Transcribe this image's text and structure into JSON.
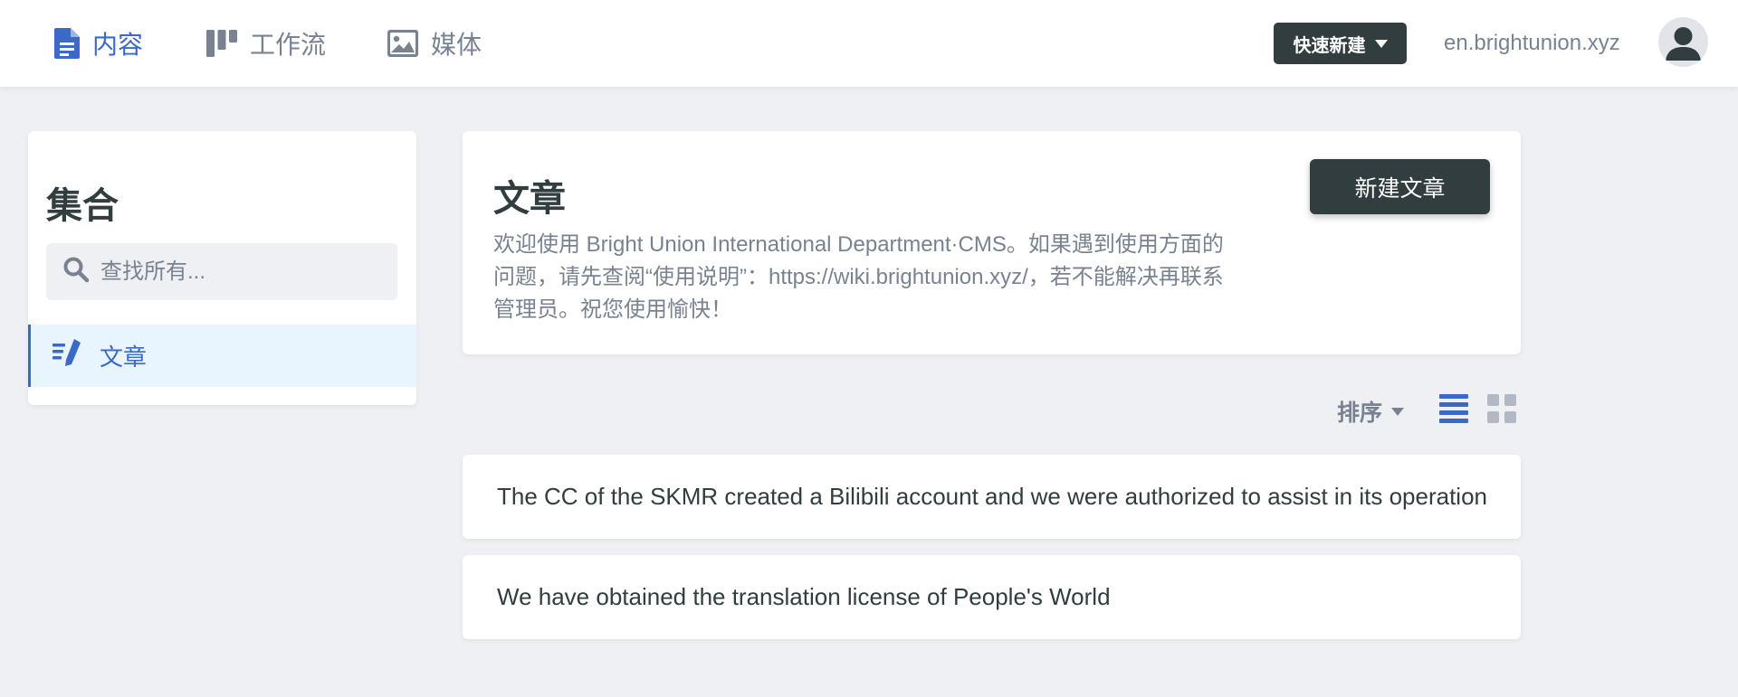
{
  "nav": {
    "tabs": [
      {
        "label": "内容",
        "icon": "document-icon",
        "active": true
      },
      {
        "label": "工作流",
        "icon": "workflow-board-icon",
        "active": false
      },
      {
        "label": "媒体",
        "icon": "image-icon",
        "active": false
      }
    ],
    "quick_new_label": "快速新建",
    "site_url": "en.brightunion.xyz"
  },
  "sidebar": {
    "title": "集合",
    "search_placeholder": "查找所有...",
    "collections": [
      {
        "label": "文章",
        "icon": "write-icon",
        "active": true
      }
    ]
  },
  "collection": {
    "title": "文章",
    "description": "欢迎使用 Bright Union International Department·CMS。如果遇到使用方面的问题，请先查阅“使用说明”：https://wiki.brightunion.xyz/，若不能解决再联系管理员。祝您使用愉快！",
    "new_button_label": "新建文章"
  },
  "controls": {
    "sort_label": "排序",
    "view_modes": [
      {
        "name": "list",
        "icon": "list-view-icon",
        "active": true
      },
      {
        "name": "grid",
        "icon": "grid-view-icon",
        "active": false
      }
    ]
  },
  "entries": [
    {
      "title": "The CC of the SKMR created a Bilibili account and we were authorized to assist in its operation"
    },
    {
      "title": "We have obtained the translation license of People's World"
    }
  ],
  "colors": {
    "accent": "#3a69c7",
    "dark": "#313d3e",
    "muted": "#798291",
    "background": "#eff0f4",
    "active_item_bg": "#e8f5fe"
  }
}
